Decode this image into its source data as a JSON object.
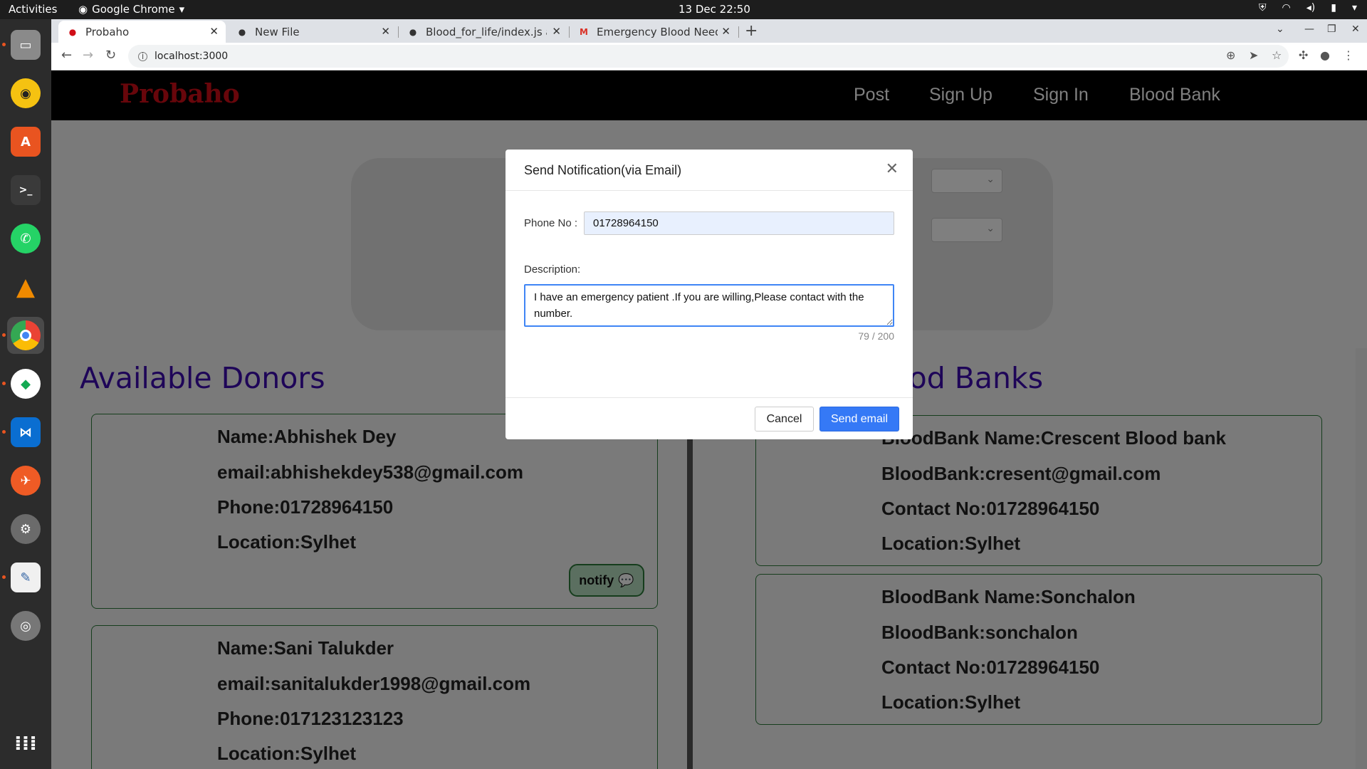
{
  "os": {
    "activities": "Activities",
    "app_menu": "Google Chrome",
    "clock": "13 Dec  22:50"
  },
  "browser": {
    "tabs": [
      {
        "label": "Probaho",
        "icon": "probaho-favicon"
      },
      {
        "label": "New File",
        "icon": "github-icon"
      },
      {
        "label": "Blood_for_life/index.js at",
        "icon": "github-icon"
      },
      {
        "label": "Emergency Blood Neede",
        "icon": "gmail-icon"
      }
    ],
    "url": "localhost:3000"
  },
  "site": {
    "brand": "Probaho",
    "nav": [
      "Post",
      "Sign Up",
      "Sign In",
      "Blood Bank"
    ],
    "donors_title": "Available Donors",
    "banks_title": "Blood Banks",
    "donors": [
      {
        "name": "Name:Abhishek Dey",
        "email": "email:abhishekdey538@gmail.com",
        "phone": "Phone:01728964150",
        "location": "Location:Sylhet"
      },
      {
        "name": "Name:Sani Talukder",
        "email": "email:sanitalukder1998@gmail.com",
        "phone": "Phone:017123123123",
        "location": "Location:Sylhet"
      }
    ],
    "notify_label": "notify",
    "banks": [
      {
        "name": "BloodBank Name:Crescent Blood bank",
        "email": "BloodBank:cresent@gmail.com",
        "contact": "Contact No:01728964150",
        "location": "Location:Sylhet"
      },
      {
        "name": "BloodBank Name:Sonchalon",
        "email": "BloodBank:sonchalon",
        "contact": "Contact No:01728964150",
        "location": "Location:Sylhet"
      }
    ]
  },
  "modal": {
    "title": "Send Notification(via Email)",
    "phone_label": "Phone No :",
    "phone_value": "01728964150",
    "description_label": "Description:",
    "description_value": "I have an emergency patient .If you are willing,Please contact with the number.",
    "counter": "79 / 200",
    "cancel_label": "Cancel",
    "send_label": "Send email"
  },
  "colors": {
    "brand": "#d00d17",
    "section_title": "#3d0bb0",
    "primary_button": "#3579f6",
    "card_border": "#2d7a3a"
  }
}
